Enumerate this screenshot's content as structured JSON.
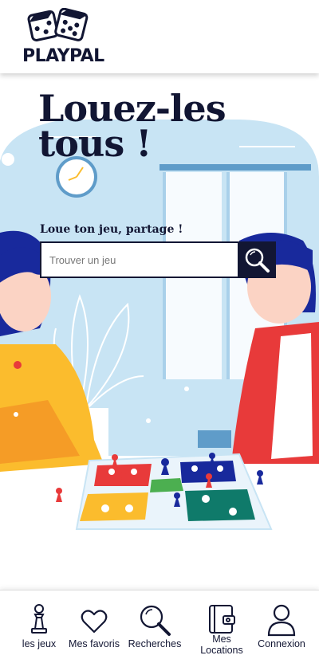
{
  "header": {
    "logo_text": "PLAYPAL",
    "logo_icon": "dice-icon"
  },
  "hero": {
    "title_line1": "Louez-les",
    "title_line2": "tous !",
    "subtitle": "Loue ton jeu, partage !",
    "search": {
      "placeholder": "Trouver un jeu",
      "value": "",
      "button_icon": "search-icon"
    }
  },
  "nav": {
    "items": [
      {
        "label": "les jeux",
        "icon": "chess-pawn-icon"
      },
      {
        "label": "Mes favoris",
        "icon": "heart-icon"
      },
      {
        "label": "Recherches",
        "icon": "search-icon"
      },
      {
        "label_line1": "Mes",
        "label_line2": "Locations",
        "icon": "wallet-icon"
      },
      {
        "label": "Connexion",
        "icon": "user-icon"
      }
    ]
  },
  "colors": {
    "navy": "#121633",
    "sky": "#c8e4f4",
    "accent_red": "#e83a3a",
    "accent_yellow": "#fbbc2d"
  }
}
